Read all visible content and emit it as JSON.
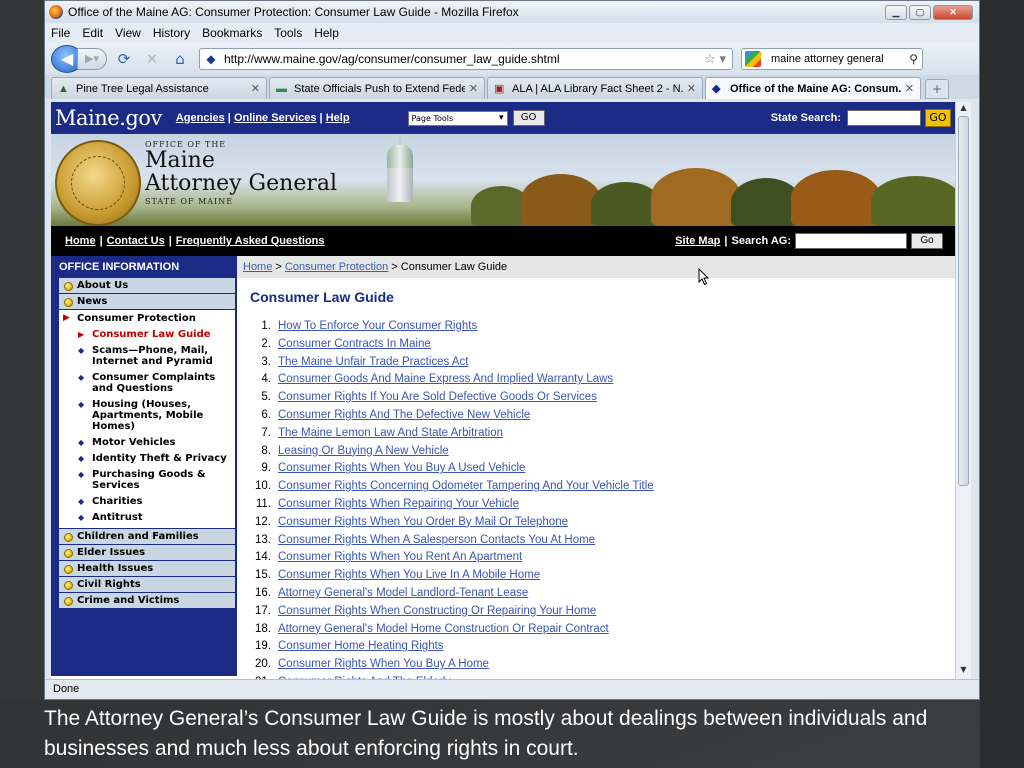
{
  "browser": {
    "window_title": "Office of the Maine AG: Consumer Protection: Consumer Law Guide - Mozilla Firefox",
    "menu": [
      "File",
      "Edit",
      "View",
      "History",
      "Bookmarks",
      "Tools",
      "Help"
    ],
    "url": "http://www.maine.gov/ag/consumer/consumer_law_guide.shtml",
    "search_value": "maine attorney general",
    "tabs": [
      {
        "label": "Pine Tree Legal Assistance",
        "icon": "tree-icon"
      },
      {
        "label": "State Officials Push to Extend Fede...",
        "icon": "news-icon"
      },
      {
        "label": "ALA | ALA Library Fact Sheet 2 - N...",
        "icon": "book-icon"
      },
      {
        "label": "Office of the Maine AG: Consum...",
        "icon": "maine-icon",
        "active": true
      }
    ],
    "status": "Done"
  },
  "site": {
    "logo": "Maine.gov",
    "top_links": [
      "Agencies",
      "Online Services",
      "Help"
    ],
    "page_tools_label": "Page Tools",
    "go_label": "GO",
    "state_search_label": "State Search:",
    "state_go_label": "GO",
    "banner": {
      "office_of": "OFFICE OF THE",
      "line1": "Maine",
      "line2": "Attorney General",
      "state_of": "STATE OF MAINE"
    },
    "secondary_links": [
      "Home",
      "Contact Us",
      "Frequently Asked Questions"
    ],
    "site_map_label": "Site Map",
    "search_ag_label": "Search AG:",
    "search_ag_go": "Go"
  },
  "leftnav": {
    "heading": "OFFICE INFORMATION",
    "top_items": [
      "About Us",
      "News"
    ],
    "group_title": "Consumer Protection",
    "sub_items": [
      {
        "label": "Consumer Law Guide",
        "current": true
      },
      {
        "label": "Scams—Phone, Mail, Internet and Pyramid"
      },
      {
        "label": "Consumer Complaints and Questions"
      },
      {
        "label": "Housing (Houses, Apartments, Mobile Homes)"
      },
      {
        "label": "Motor Vehicles"
      },
      {
        "label": "Identity Theft & Privacy"
      },
      {
        "label": "Purchasing Goods & Services"
      },
      {
        "label": "Charities"
      },
      {
        "label": "Antitrust"
      }
    ],
    "bottom_items": [
      "Children and Families",
      "Elder Issues",
      "Health Issues",
      "Civil Rights",
      "Crime and Victims"
    ]
  },
  "content": {
    "breadcrumb": [
      "Home",
      "Consumer Protection",
      "Consumer Law Guide"
    ],
    "title": "Consumer Law Guide",
    "items": [
      "How To Enforce Your Consumer Rights",
      "Consumer Contracts In Maine",
      "The Maine Unfair Trade Practices Act",
      "Consumer Goods And Maine Express And Implied Warranty Laws",
      "Consumer Rights If You Are Sold Defective Goods Or Services",
      "Consumer Rights And The Defective New Vehicle",
      "The Maine Lemon Law And State Arbitration",
      "Leasing Or Buying A New Vehicle",
      "Consumer Rights When You Buy A Used Vehicle",
      "Consumer Rights Concerning Odometer Tampering And Your Vehicle Title",
      "Consumer Rights When Repairing Your Vehicle",
      "Consumer Rights When You Order By Mail Or Telephone",
      "Consumer Rights When A Salesperson Contacts You At Home",
      "Consumer Rights When You Rent An Apartment",
      "Consumer Rights When You Live In A Mobile Home",
      "Attorney General's Model Landlord-Tenant Lease",
      "Consumer Rights When Constructing Or Repairing Your Home",
      "Attorney General's Model Home Construction Or Repair Contract",
      "Consumer Home Heating Rights",
      "Consumer Rights When You Buy A Home",
      "Consumer Rights And The Elderly"
    ]
  },
  "caption": "The Attorney General’s Consumer Law Guide is mostly about dealings between individuals and businesses and much less about enforcing rights in court.",
  "colors": {
    "maine_blue": "#1a2a85",
    "link_blue": "#3a55b5",
    "nav_bg": "#c9d6e4",
    "go_yellow": "#f2c200",
    "current_red": "#c00000"
  }
}
